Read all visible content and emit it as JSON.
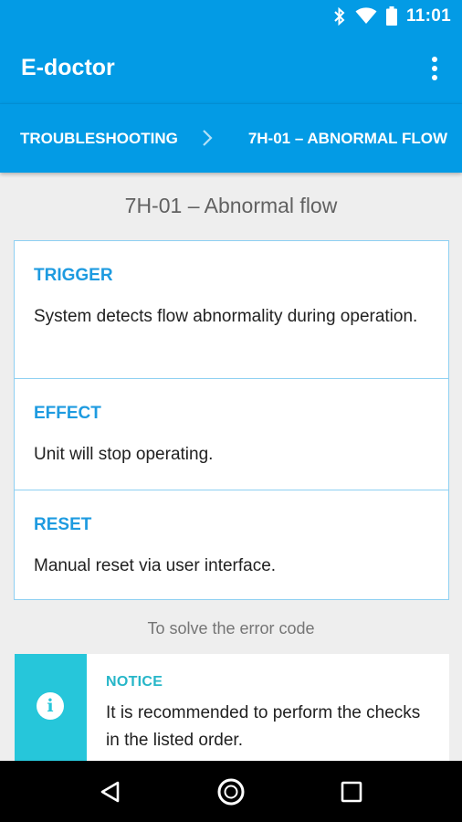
{
  "status_bar": {
    "time": "11:01",
    "icons": [
      "bluetooth-icon",
      "wifi-icon",
      "battery-icon"
    ]
  },
  "app_bar": {
    "title": "E-doctor",
    "menu_icon": "more-vert-icon"
  },
  "breadcrumb": {
    "items": [
      "TROUBLESHOOTING",
      "7H-01 – ABNORMAL FLOW"
    ],
    "separator_icon": "chevron-right-icon"
  },
  "page": {
    "title": "7H-01 – Abnormal flow"
  },
  "sections": [
    {
      "heading": "TRIGGER",
      "body": "System detects flow abnormality during operation."
    },
    {
      "heading": "EFFECT",
      "body": "Unit will stop operating."
    },
    {
      "heading": "RESET",
      "body": "Manual reset via user interface."
    }
  ],
  "solve_label": "To solve the error code",
  "notice": {
    "icon": "info-icon",
    "heading": "NOTICE",
    "body": "It is recommended to perform the checks in the listed order."
  },
  "nav_bar": {
    "buttons": [
      "back-icon",
      "home-icon",
      "recents-icon"
    ]
  },
  "colors": {
    "primary": "#039be5",
    "accent_text": "#1e9be0",
    "notice_stripe": "#26c6da",
    "card_border": "#8ed0f2"
  }
}
